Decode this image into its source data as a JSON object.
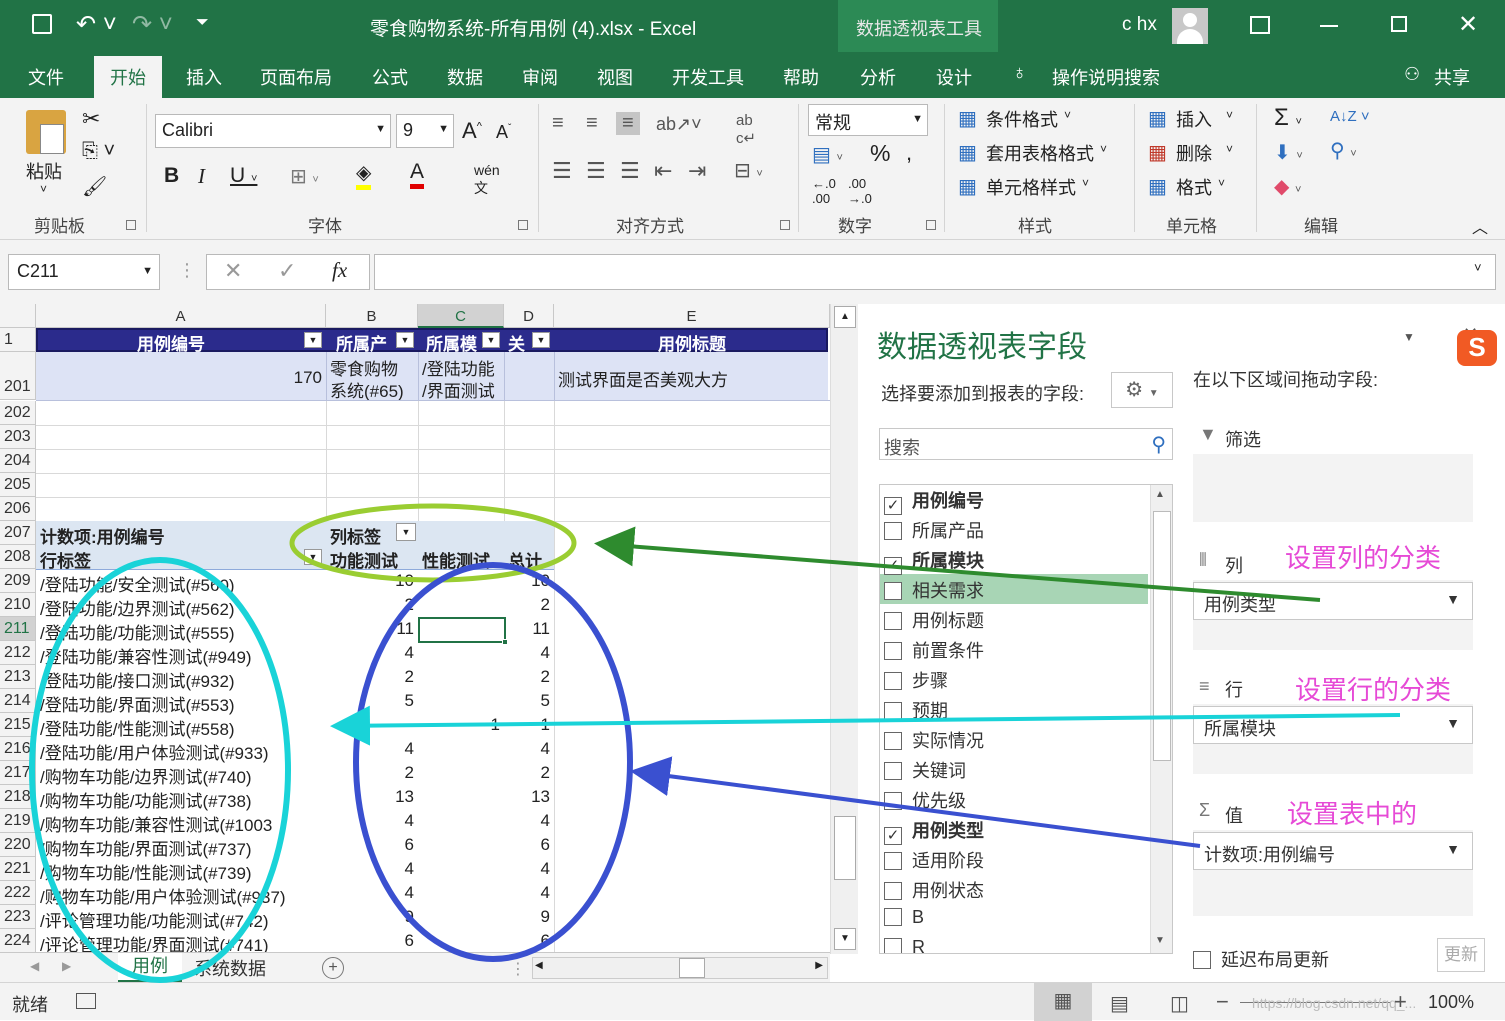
{
  "title_bar": {
    "title": "零食购物系统-所有用例 (4).xlsx  -  Excel",
    "context_tab": "数据透视表工具",
    "user": "c hx"
  },
  "ribbon_tabs": [
    "文件",
    "开始",
    "插入",
    "页面布局",
    "公式",
    "数据",
    "审阅",
    "视图",
    "开发工具",
    "帮助",
    "分析",
    "设计"
  ],
  "tell_me": "操作说明搜索",
  "share": "共享",
  "ribbon": {
    "paste": "粘贴",
    "clipboard": "剪贴板",
    "font_name": "Calibri",
    "font_size": "9",
    "font_group": "字体",
    "align_group": "对齐方式",
    "number_format": "常规",
    "number_group": "数字",
    "cond_format": "条件格式",
    "table_format": "套用表格格式",
    "cell_style": "单元格样式",
    "styles_group": "样式",
    "insert": "插入",
    "delete": "删除",
    "format": "格式",
    "cells_group": "单元格",
    "edit_group": "编辑"
  },
  "formula_bar": {
    "name_box": "C211",
    "fx": "fx",
    "formula": ""
  },
  "columns": [
    "A",
    "B",
    "C",
    "D",
    "E"
  ],
  "header_row": {
    "row": "1",
    "a": "用例编号",
    "b": "所属产",
    "c": "所属模",
    "d": "关",
    "e": "用例标题"
  },
  "row201": {
    "row": "201",
    "a": "170",
    "b1": "零食购物",
    "b2": "系统(#65)",
    "c1": "/登陆功能",
    "c2": "/界面测试",
    "e": "测试界面是否美观大方"
  },
  "empty_rows": [
    "202",
    "203",
    "204",
    "205",
    "206"
  ],
  "pivot": {
    "row207": "207",
    "row208": "208",
    "title": "计数项:用例编号",
    "col_label": "列标签",
    "row_label": "行标签",
    "h_func": "功能测试",
    "h_perf": "性能测试",
    "h_total": "总计",
    "rows": [
      {
        "n": "209",
        "label": "/登陆功能/安全测试(#560)",
        "f": "10",
        "p": "",
        "t": "10"
      },
      {
        "n": "210",
        "label": "/登陆功能/边界测试(#562)",
        "f": "2",
        "p": "",
        "t": "2"
      },
      {
        "n": "211",
        "label": "/登陆功能/功能测试(#555)",
        "f": "11",
        "p": "",
        "t": "11"
      },
      {
        "n": "212",
        "label": "/登陆功能/兼容性测试(#949)",
        "f": "4",
        "p": "",
        "t": "4"
      },
      {
        "n": "213",
        "label": "/登陆功能/接口测试(#932)",
        "f": "2",
        "p": "",
        "t": "2"
      },
      {
        "n": "214",
        "label": "/登陆功能/界面测试(#553)",
        "f": "5",
        "p": "",
        "t": "5"
      },
      {
        "n": "215",
        "label": "/登陆功能/性能测试(#558)",
        "f": "",
        "p": "1",
        "t": "1"
      },
      {
        "n": "216",
        "label": "/登陆功能/用户体验测试(#933)",
        "f": "4",
        "p": "",
        "t": "4"
      },
      {
        "n": "217",
        "label": "/购物车功能/边界测试(#740)",
        "f": "2",
        "p": "",
        "t": "2"
      },
      {
        "n": "218",
        "label": "/购物车功能/功能测试(#738)",
        "f": "13",
        "p": "",
        "t": "13"
      },
      {
        "n": "219",
        "label": "/购物车功能/兼容性测试(#1003",
        "f": "4",
        "p": "",
        "t": "4"
      },
      {
        "n": "220",
        "label": "/购物车功能/界面测试(#737)",
        "f": "6",
        "p": "",
        "t": "6"
      },
      {
        "n": "221",
        "label": "/购物车功能/性能测试(#739)",
        "f": "4",
        "p": "",
        "t": "4"
      },
      {
        "n": "222",
        "label": "/购物车功能/用户体验测试(#937)",
        "f": "4",
        "p": "",
        "t": "4"
      },
      {
        "n": "223",
        "label": "/评论管理功能/功能测试(#742)",
        "f": "9",
        "p": "",
        "t": "9"
      },
      {
        "n": "224",
        "label": "/评论管理功能/界面测试(#741)",
        "f": "6",
        "p": "",
        "t": "6"
      }
    ]
  },
  "sheet_tabs": [
    "用例",
    "系统数据"
  ],
  "pane": {
    "title": "数据透视表字段",
    "choose": "选择要添加到报表的字段:",
    "search_placeholder": "搜索",
    "drag_hint": "在以下区域间拖动字段:",
    "filter": "筛选",
    "columns": "列",
    "rows": "行",
    "values": "值",
    "col_value": "用例类型",
    "row_value": "所属模块",
    "val_value": "计数项:用例编号",
    "defer": "延迟布局更新",
    "update": "更新",
    "fields": [
      {
        "name": "用例编号",
        "checked": true
      },
      {
        "name": "所属产品",
        "checked": false
      },
      {
        "name": "所属模块",
        "checked": true
      },
      {
        "name": "相关需求",
        "checked": false
      },
      {
        "name": "用例标题",
        "checked": false
      },
      {
        "name": "前置条件",
        "checked": false
      },
      {
        "name": "步骤",
        "checked": false
      },
      {
        "name": "预期",
        "checked": false
      },
      {
        "name": "实际情况",
        "checked": false
      },
      {
        "name": "关键词",
        "checked": false
      },
      {
        "name": "优先级",
        "checked": false
      },
      {
        "name": "用例类型",
        "checked": true
      },
      {
        "name": "适用阶段",
        "checked": false
      },
      {
        "name": "用例状态",
        "checked": false
      },
      {
        "name": "B",
        "checked": false
      },
      {
        "name": "R",
        "checked": false
      }
    ]
  },
  "annotations": {
    "col": "设置列的分类",
    "row": "设置行的分类",
    "val": "设置表中的"
  },
  "status": {
    "ready": "就绪",
    "zoom": "100%",
    "watermark": "https://blog.csdn.net/qq_..."
  },
  "colors": {
    "excel_green": "#217346",
    "pivot_header": "#2b2b8c",
    "annot_pink": "#e64ad6"
  }
}
